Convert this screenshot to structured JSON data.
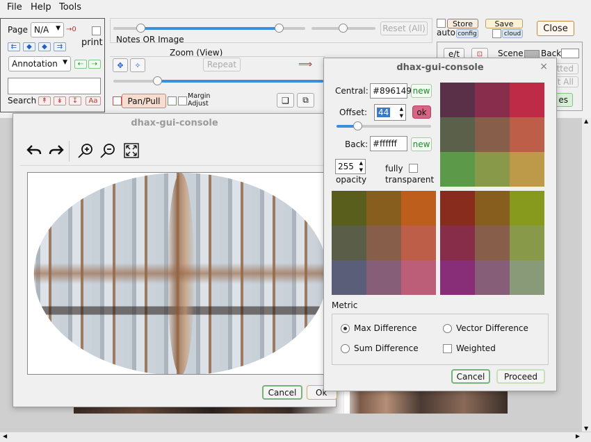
{
  "menu": {
    "file": "File",
    "help": "Help",
    "tools": "Tools"
  },
  "left_panel": {
    "page_label": "Page",
    "page_select": "N/A",
    "page_count": "→0",
    "print_label": "print",
    "annotation_select": "Annotation",
    "search_label": "Search",
    "search_value": "",
    "case_button": "Aa"
  },
  "toolbar": {
    "notes_or_image": "Notes OR Image",
    "zoom_view": "Zoom (View)",
    "reset_all": "Reset (All)",
    "repeat": "Repeat",
    "pan_pull": "Pan/Pull",
    "margin_label": "Margin",
    "adjust_label": "Adjust",
    "store": "Store",
    "save": "Save",
    "auto": "auto",
    "config": "config",
    "cloud": "cloud",
    "close": "Close",
    "et": "e/t",
    "scene": "Scene",
    "back": "Back",
    "hidden_a": "tted",
    "hidden_b": "t All",
    "hidden_c": "es"
  },
  "image_dialog": {
    "title": "dhax-gui-console",
    "cancel": "Cancel",
    "ok": "Ok"
  },
  "color_dialog": {
    "title": "dhax-gui-console",
    "central_label": "Central:",
    "central_value": "#896149",
    "new_label": "new",
    "offset_label": "Offset:",
    "offset_value": "44",
    "ok_label": "ok",
    "back_label": "Back:",
    "back_value": "#ffffff",
    "opacity_value": "255",
    "opacity_label": "opacity",
    "fully_label": "fully",
    "transparent_label": "transparent",
    "metric_label": "Metric",
    "metric_options": [
      "Max Difference",
      "Vector Difference",
      "Sum Difference",
      "Weighted"
    ],
    "selected_metric": "Max Difference",
    "cancel": "Cancel",
    "proceed": "Proceed",
    "offset_slider_fraction": 0.22,
    "swatch_grid_1": [
      "#5a3049",
      "#882d4c",
      "#bd2b47",
      "#5a6049",
      "#875e49",
      "#bd5e49",
      "#5c9a49",
      "#889a49",
      "#bd9a49"
    ],
    "swatch_grid_2": [
      "#5a5e1d",
      "#875e1d",
      "#bd5e1d",
      "#5a5e49",
      "#875e49",
      "#bd5e49",
      "#5a5e78",
      "#875e78",
      "#bd5e78"
    ],
    "swatch_grid_3": [
      "#882d1d",
      "#875e1d",
      "#889a1d",
      "#882d49",
      "#875e49",
      "#889a49",
      "#882d78",
      "#875e78",
      "#889a78"
    ]
  },
  "colors": {
    "accent": "#3b8ee0",
    "red": "#c0302e",
    "green_border": "#a9c9a9",
    "ok_pink": "#d96585"
  }
}
